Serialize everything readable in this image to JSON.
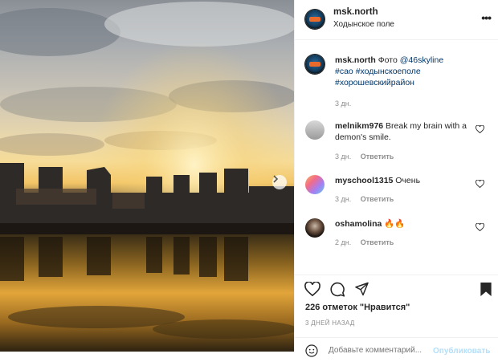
{
  "header": {
    "username": "msk.north",
    "location": "Ходынское поле",
    "more_label": "•••"
  },
  "caption": {
    "username": "msk.north",
    "text_prefix": "Фото",
    "mention": "@46skyline",
    "hashtags": [
      "#сао",
      "#ходынскоеполе",
      "#хорошевскийрайон"
    ],
    "time": "3 дн."
  },
  "comments": [
    {
      "username": "melnikm976",
      "text": "Break my brain with a demon's smile.",
      "time": "3 дн.",
      "reply": "Ответить"
    },
    {
      "username": "myschool1315",
      "text": "Очень",
      "time": "3 дн.",
      "reply": "Ответить"
    },
    {
      "username": "oshamolina",
      "text": "🔥🔥",
      "time": "2 дн.",
      "reply": "Ответить"
    }
  ],
  "likes": "226 отметок \"Нравится\"",
  "date": "3 ДНЕЙ НАЗАД",
  "composer": {
    "placeholder": "Добавьте комментарий...",
    "post_label": "Опубликовать"
  },
  "colors": {
    "link": "#00376b",
    "muted": "#8e8e8e",
    "post_disabled": "#b2dffc"
  }
}
